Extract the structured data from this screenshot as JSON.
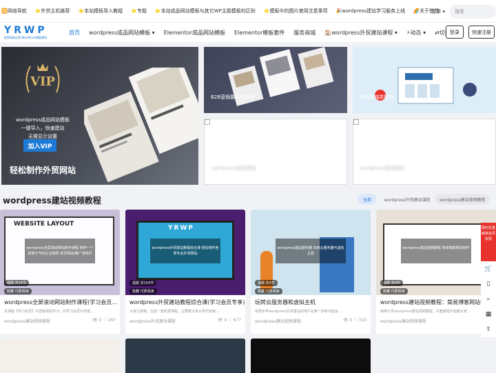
{
  "topbar": {
    "links": [
      "🔀网络导航",
      "⭐外贸主机推荐",
      "⭐本站模板导入教程",
      "⭐专题",
      "⭐本站成品网站模板与其它WP主题模板的区别",
      "⭐模板中的图片使用注意事项",
      "🎉wordpress建站学习服务上线",
      "🌈关于悦然"
    ],
    "lang": "文章 ▾",
    "search_placeholder": "搜索"
  },
  "nav": {
    "logo": "YRWP",
    "logo_sub": "悦然网络点滴-WordPress模板建站",
    "items": [
      "首页",
      "wordpress成品网站模板 ▾",
      "Elementor成品网站模板",
      "Elementor模板套件",
      "服务商城",
      "🏠wordpress外贸建站课程 ▾",
      "⚡动态 ▾",
      "⇄切换 繁體"
    ],
    "login": "登录",
    "register": "快速注册"
  },
  "hero": {
    "vip": "VIP",
    "line1": "wordpress成品网站模板",
    "line2": "一键导入，快速建站",
    "line3": "无需显示设置",
    "join": "加入VIP",
    "slogan": "轻松制作外贸网站"
  },
  "cards": {
    "b2b": "B2B营销展示型模板",
    "b2c": "B2C商城类模板",
    "course": "wordpress建站课程",
    "service": "wordpress建站服务"
  },
  "section": {
    "title": "wordpress建站视频教程",
    "tabs": [
      "全部",
      "wordpress外贸建站课程",
      "wordpress建站视频教程"
    ]
  },
  "videos": [
    {
      "title": "wordpress全屏滚动网站制作课程(学习会员…",
      "desc": "本课程【学习会员】可直接观看学习，非学习会员可单独…",
      "cat": "wordpress建站视频课程",
      "views": "0",
      "likes": "297",
      "overlay": "wordpress全屏滚动网站制作课程 制作一个高端大气的企业官网 单页网站/推广落地页",
      "badge1": "视频",
      "badge2": "隐藏",
      "badge2_text": "付费阅读",
      "badge1_text": "共15节"
    },
    {
      "title": "wordpress外贸建站教程综合课(学习会员专享)",
      "desc": "大家注意哦，这是一套收费课程，主要教大家从零开始制…",
      "cat": "wordpress外贸建站课程",
      "views": "0",
      "likes": "677",
      "overlay": "wordpress外贸建站教程综合课 轻松制作各类专业外贸网站",
      "badge1": "视频",
      "badge1_text": "共154节",
      "badge2": "隐藏",
      "badge2_text": "付费阅读"
    },
    {
      "title": "玩转云服务器和虚拟主机",
      "desc": "有很多学wordpress外贸建站的用户在第一步就可能会…",
      "cat": "wordpress建站视频课程",
      "views": "0",
      "likes": "310",
      "overlay": "wordpress建站服务器 玩转云服务器与虚拟主机",
      "badge1": "视频",
      "badge1_text": "共3节",
      "badge2": "隐藏",
      "badge2_text": "付费阅读"
    },
    {
      "title": "wordpress建站视频教程：简易博客网站制作…",
      "desc": "继续分享wordpress建站视频教程，本套教程开始教大家…",
      "cat": "wordpress建站视频课程",
      "views": "0",
      "likes": "",
      "overlay": "wordpress建站视频教程 简易博客网站制作",
      "badge1": "视频",
      "badge1_text": "共9节",
      "badge2": "隐藏",
      "badge2_text": "付费阅读"
    }
  ],
  "sidebar": {
    "red": "限时优惠 解锁会员权限",
    "icons": [
      "cart-icon",
      "book-icon",
      "search-icon",
      "qr-icon",
      "top-icon"
    ]
  },
  "colors": {
    "accent": "#1d7bd7",
    "red": "#e8322e"
  }
}
